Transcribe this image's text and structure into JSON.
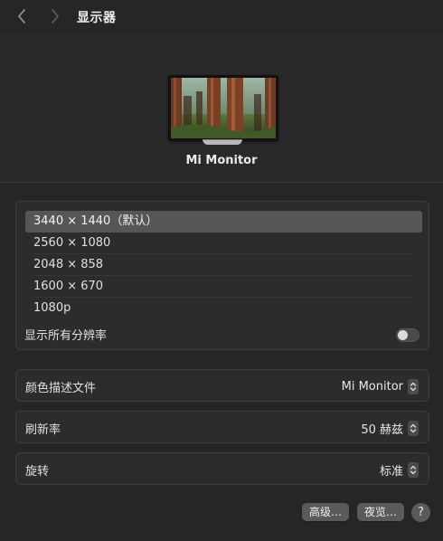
{
  "toolbar": {
    "back_icon": "chevron-left-icon",
    "forward_icon": "chevron-right-icon",
    "title": "显示器"
  },
  "display": {
    "name": "Mi Monitor",
    "wallpaper": "redwood-forest"
  },
  "resolutions": {
    "items": [
      "3440 × 1440（默认）",
      "2560 × 1080",
      "2048 × 858",
      "1600 × 670",
      "1080p"
    ],
    "selected_index": 0,
    "show_all_label": "显示所有分辨率",
    "show_all_enabled": false
  },
  "settings": {
    "color_profile": {
      "label": "颜色描述文件",
      "value": "Mi Monitor"
    },
    "refresh_rate": {
      "label": "刷新率",
      "value": "50 赫兹"
    },
    "rotation": {
      "label": "旋转",
      "value": "标准"
    }
  },
  "buttons": {
    "advanced": "高级…",
    "night_shift": "夜览…",
    "help": "?"
  },
  "colors": {
    "background": "#262626",
    "panel": "#2c2c2c",
    "selected_row": "#565656",
    "button": "#5a5a5a"
  }
}
